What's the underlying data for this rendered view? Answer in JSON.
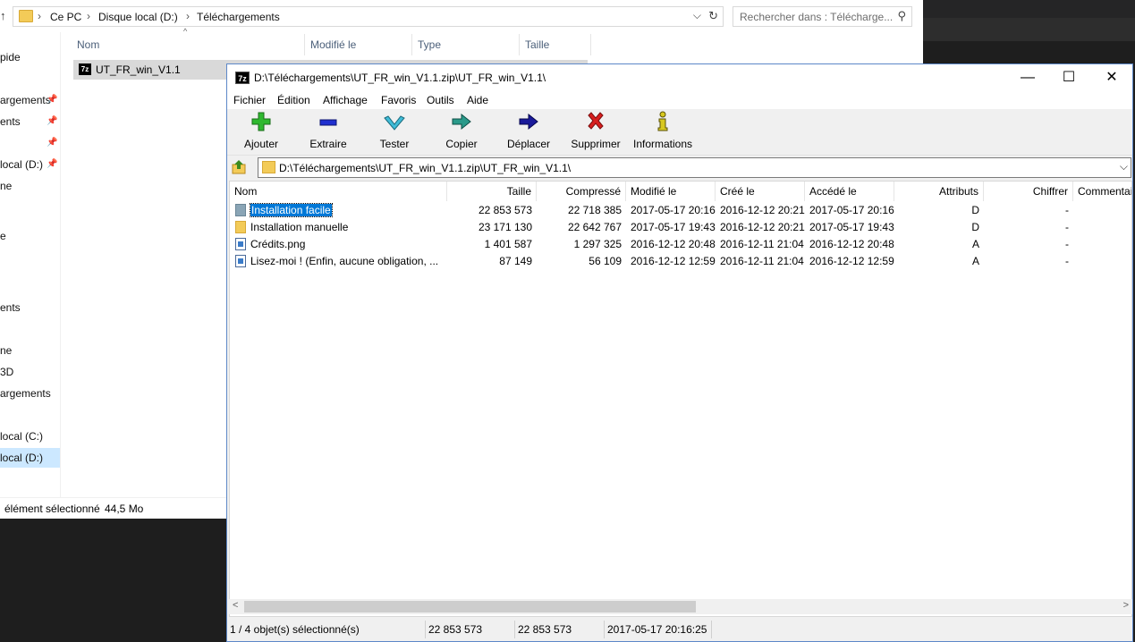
{
  "explorer": {
    "breadcrumbs": [
      "Ce PC",
      "Disque local (D:)",
      "Téléchargements"
    ],
    "search_placeholder": "Rechercher dans : Télécharge...",
    "columns": [
      "Nom",
      "Modifié le",
      "Type",
      "Taille"
    ],
    "nav_items": [
      {
        "label": "pide",
        "pinned": false
      },
      {
        "label": "argements",
        "pinned": true
      },
      {
        "label": "ents",
        "pinned": true
      },
      {
        "label": "",
        "pinned": true
      },
      {
        "label": "local (D:)",
        "pinned": true
      },
      {
        "label": "ne",
        "pinned": false
      },
      {
        "label": "e",
        "pinned": false
      },
      {
        "label": "ents",
        "pinned": false
      },
      {
        "label": "ne",
        "pinned": false
      },
      {
        "label": "3D",
        "pinned": false
      },
      {
        "label": "argements",
        "pinned": false
      },
      {
        "label": "local (C:)",
        "pinned": false
      },
      {
        "label": "local (D:)",
        "pinned": false
      }
    ],
    "file_row": {
      "icon": "7z",
      "name": "UT_FR_win_V1.1"
    },
    "status": {
      "selected": "élément sélectionné",
      "size": "44,5 Mo"
    }
  },
  "sevenzip": {
    "app_icon": "7z",
    "title": "D:\\Téléchargements\\UT_FR_win_V1.1.zip\\UT_FR_win_V1.1\\",
    "menu": [
      "Fichier",
      "Édition",
      "Affichage",
      "Favoris",
      "Outils",
      "Aide"
    ],
    "toolbar": [
      {
        "label": "Ajouter",
        "icon": "plus-icon",
        "color": "#2fb82f"
      },
      {
        "label": "Extraire",
        "icon": "minus-icon",
        "color": "#1f2fcf"
      },
      {
        "label": "Tester",
        "icon": "check-icon",
        "color": "#3fbcd8"
      },
      {
        "label": "Copier",
        "icon": "copy-arrow-icon",
        "color": "#2a9a8a"
      },
      {
        "label": "Déplacer",
        "icon": "move-arrow-icon",
        "color": "#1a1a9a"
      },
      {
        "label": "Supprimer",
        "icon": "delete-x-icon",
        "color": "#d81e1e"
      },
      {
        "label": "Informations",
        "icon": "info-icon",
        "color": "#d8c81e"
      }
    ],
    "path": "D:\\Téléchargements\\UT_FR_win_V1.1.zip\\UT_FR_win_V1.1\\",
    "columns": [
      "Nom",
      "Taille",
      "Compressé",
      "Modifié le",
      "Créé le",
      "Accédé le",
      "Attributs",
      "Chiffrer",
      "Commentai"
    ],
    "rows": [
      {
        "icon": "folder",
        "name": "Installation facile",
        "size": "22 853 573",
        "packed": "22 718 385",
        "modified": "2017-05-17 20:16",
        "created": "2016-12-12 20:21",
        "accessed": "2017-05-17 20:16",
        "attr": "D",
        "encrypted": "-"
      },
      {
        "icon": "folder",
        "name": "Installation manuelle",
        "size": "23 171 130",
        "packed": "22 642 767",
        "modified": "2017-05-17 19:43",
        "created": "2016-12-12 20:21",
        "accessed": "2017-05-17 19:43",
        "attr": "D",
        "encrypted": "-"
      },
      {
        "icon": "image",
        "name": "Crédits.png",
        "size": "1 401 587",
        "packed": "1 297 325",
        "modified": "2016-12-12 20:48",
        "created": "2016-12-11 21:04",
        "accessed": "2016-12-12 20:48",
        "attr": "A",
        "encrypted": "-"
      },
      {
        "icon": "image",
        "name": "Lisez-moi ! (Enfin, aucune obligation, ...",
        "size": "87 149",
        "packed": "56 109",
        "modified": "2016-12-12 12:59",
        "created": "2016-12-11 21:04",
        "accessed": "2016-12-12 12:59",
        "attr": "A",
        "encrypted": "-"
      }
    ],
    "status": {
      "selection": "1 / 4 objet(s) sélectionné(s)",
      "size": "22 853 573",
      "packed": "22 853 573",
      "date": "2017-05-17 20:16:25"
    }
  }
}
